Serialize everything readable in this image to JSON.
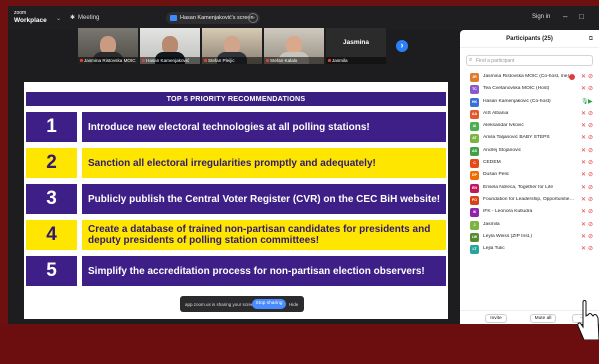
{
  "titlebar": {
    "app_name_small": "zoom",
    "app_name": "Workplace",
    "meeting_label": "Meeting",
    "screen_share_label": "Hasan Kamenjaković's screen",
    "sign_in": "Sign in"
  },
  "thumbnails": [
    {
      "name": "Jasmina Ristovska MOIC",
      "active": false
    },
    {
      "name": "Hasan Kamenjaković",
      "active": true
    },
    {
      "name": "Stefan Pleijic",
      "active": false
    },
    {
      "name": "Stefan Kalalo",
      "active": false
    },
    {
      "name": "Jasmina",
      "label": "Jasmila",
      "plain": true
    }
  ],
  "slide": {
    "title": "TOP 5 PRIORITY RECOMMENDATIONS",
    "items": [
      {
        "num": "1",
        "text": "Introduce new electoral technologies at all polling stations!",
        "style": "purple"
      },
      {
        "num": "2",
        "text": "Sanction all electoral irregularities promptly and adequately!",
        "style": "yellow"
      },
      {
        "num": "3",
        "text": "Publicly publish the Central Voter Register (CVR) on the CEC BiH website!",
        "style": "purple"
      },
      {
        "num": "4",
        "text": "Create a database of trained non-partisan candidates for presidents and deputy presidents of polling station committees!",
        "style": "yellow"
      },
      {
        "num": "5",
        "text": "Simplify the accreditation process for non-partisan election observers!",
        "style": "purple"
      }
    ]
  },
  "share_bar": {
    "message": "app.zoom.us is sharing your screen.",
    "stop_label": "Stop sharing",
    "hide_label": "Hide"
  },
  "participants": {
    "header": "Participants (25)",
    "search_placeholder": "Find a participant",
    "list": [
      {
        "initials": "JR",
        "name": "Jasmina Ristovska MOIC (Co-host, me)",
        "color": "#e07b2c",
        "mic": "off",
        "cam": "off",
        "badge": true
      },
      {
        "initials": "TC",
        "name": "Tea Cvetanovska MOIC (Host)",
        "color": "#8a58c8",
        "mic": "off",
        "cam": "off"
      },
      {
        "initials": "HK",
        "name": "Hasan Kamenjaković (Co-host)",
        "color": "#3b6fd8",
        "mic": "on",
        "cam": "on"
      },
      {
        "initials": "AA",
        "name": "AIS Albania",
        "color": "#e05a2c",
        "mic": "off",
        "cam": "off"
      },
      {
        "initials": "AI",
        "name": "Aleksandar Ivković",
        "color": "#4caf50",
        "mic": "off",
        "cam": "off"
      },
      {
        "initials": "AT",
        "name": "Amila Taljanović BABY STEPS",
        "color": "#7cb342",
        "mic": "off",
        "cam": "off"
      },
      {
        "initials": "AS",
        "name": "Andrej Stojanović",
        "color": "#43a047",
        "mic": "off",
        "cam": "off"
      },
      {
        "initials": "C",
        "name": "CEDEM",
        "color": "#e64a19",
        "mic": "off",
        "cam": "off"
      },
      {
        "initials": "DP",
        "name": "Dušan Pelić",
        "color": "#ef6c00",
        "mic": "off",
        "cam": "off"
      },
      {
        "initials": "EN",
        "name": "Erisela Ndreca, Together for Life",
        "color": "#c2185b",
        "mic": "off",
        "cam": "off"
      },
      {
        "initials": "FO",
        "name": "Foundation for Leadership, Opportunities, Le...",
        "color": "#d84315",
        "mic": "off",
        "cam": "off"
      },
      {
        "initials": "IK",
        "name": "IFK - Leonora Kulludra",
        "color": "#8e24aa",
        "mic": "off",
        "cam": "off"
      },
      {
        "initials": "J",
        "name": "Jasmila",
        "color": "#7cb342",
        "mic": "off",
        "cam": "off"
      },
      {
        "initials": "LW",
        "name": "Leyla Weiss (ZIP Inst.)",
        "color": "#558b2f",
        "mic": "off",
        "cam": "off"
      },
      {
        "initials": "LT",
        "name": "Lejla Tulic",
        "color": "#26a69a",
        "mic": "off",
        "cam": "off"
      }
    ],
    "invite_label": "Invite",
    "mute_all_label": "Mute all"
  }
}
